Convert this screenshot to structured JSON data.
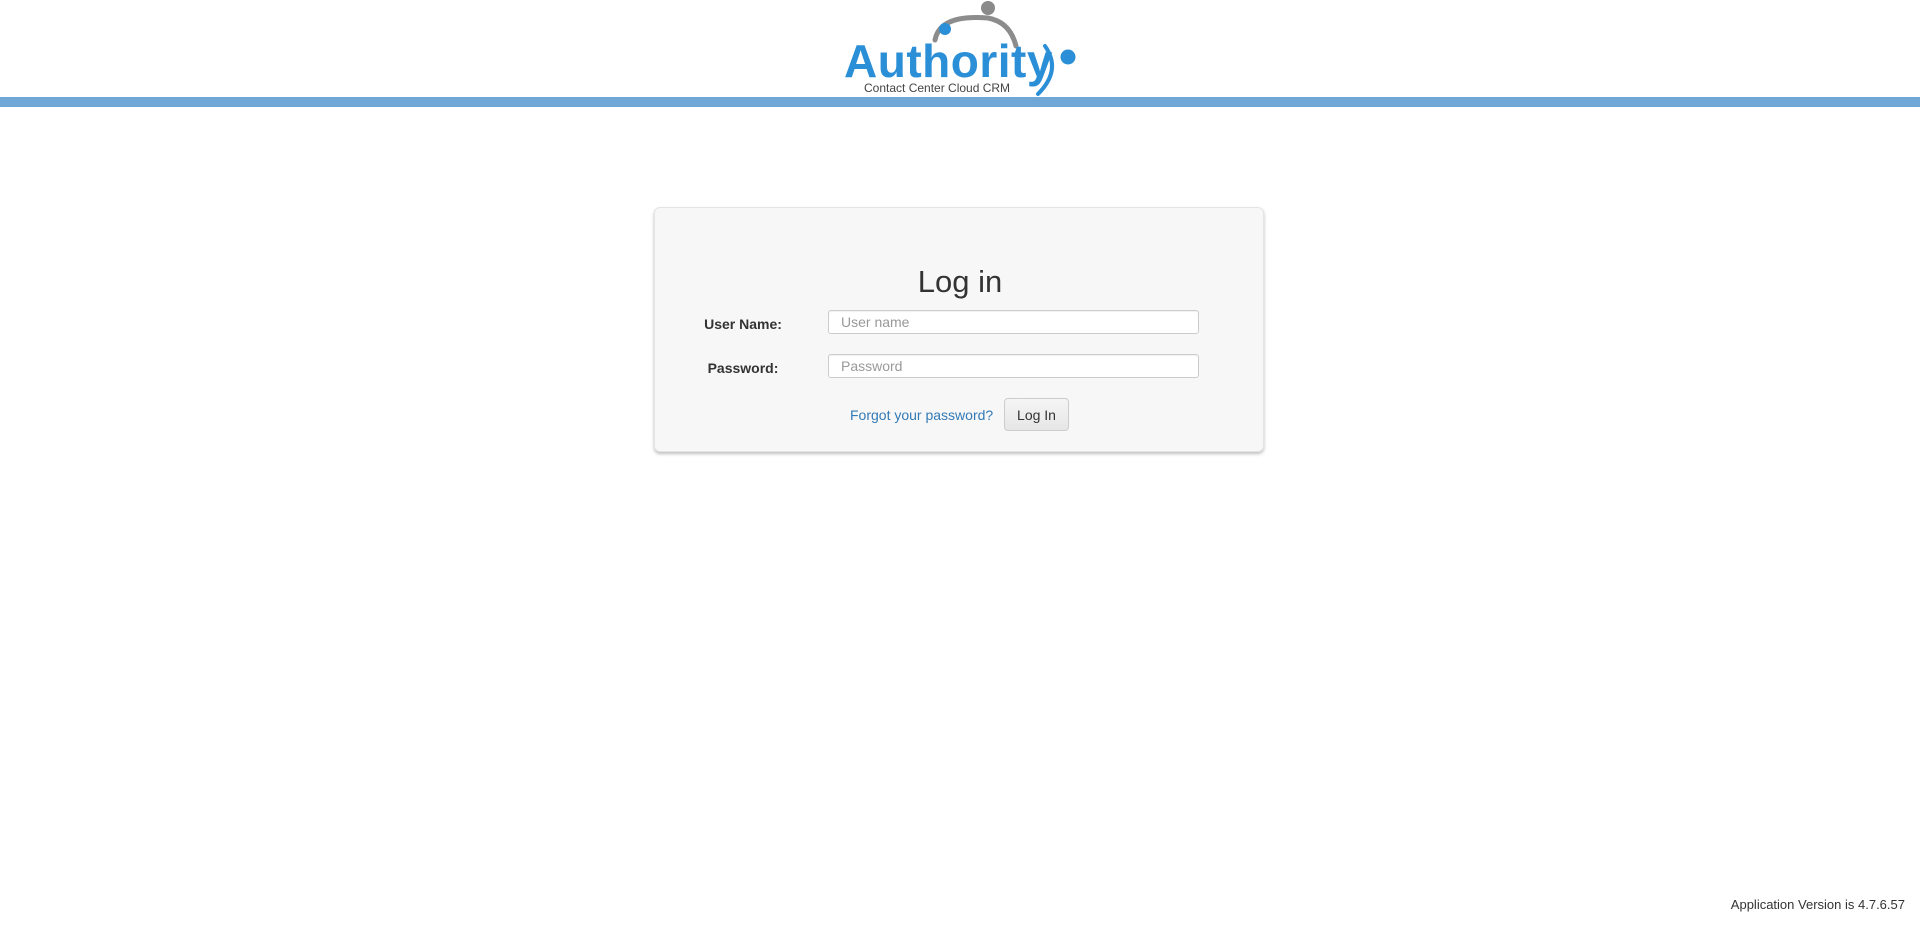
{
  "header": {
    "logo": {
      "name": "authority-logo",
      "wordmark": "Authority",
      "tagline": "Contact Center Cloud CRM",
      "colors": {
        "primary": "#2a8fd6",
        "accent": "#808080"
      }
    },
    "bar_color": "#6fa8d6"
  },
  "login": {
    "title": "Log in",
    "username": {
      "label": "User Name:",
      "placeholder": "User name",
      "value": ""
    },
    "password": {
      "label": "Password:",
      "placeholder": "Password",
      "value": ""
    },
    "forgot_link": "Forgot your password?",
    "submit_label": "Log In"
  },
  "footer": {
    "version_prefix": "Application Version is",
    "version": "4.7.6.57"
  }
}
